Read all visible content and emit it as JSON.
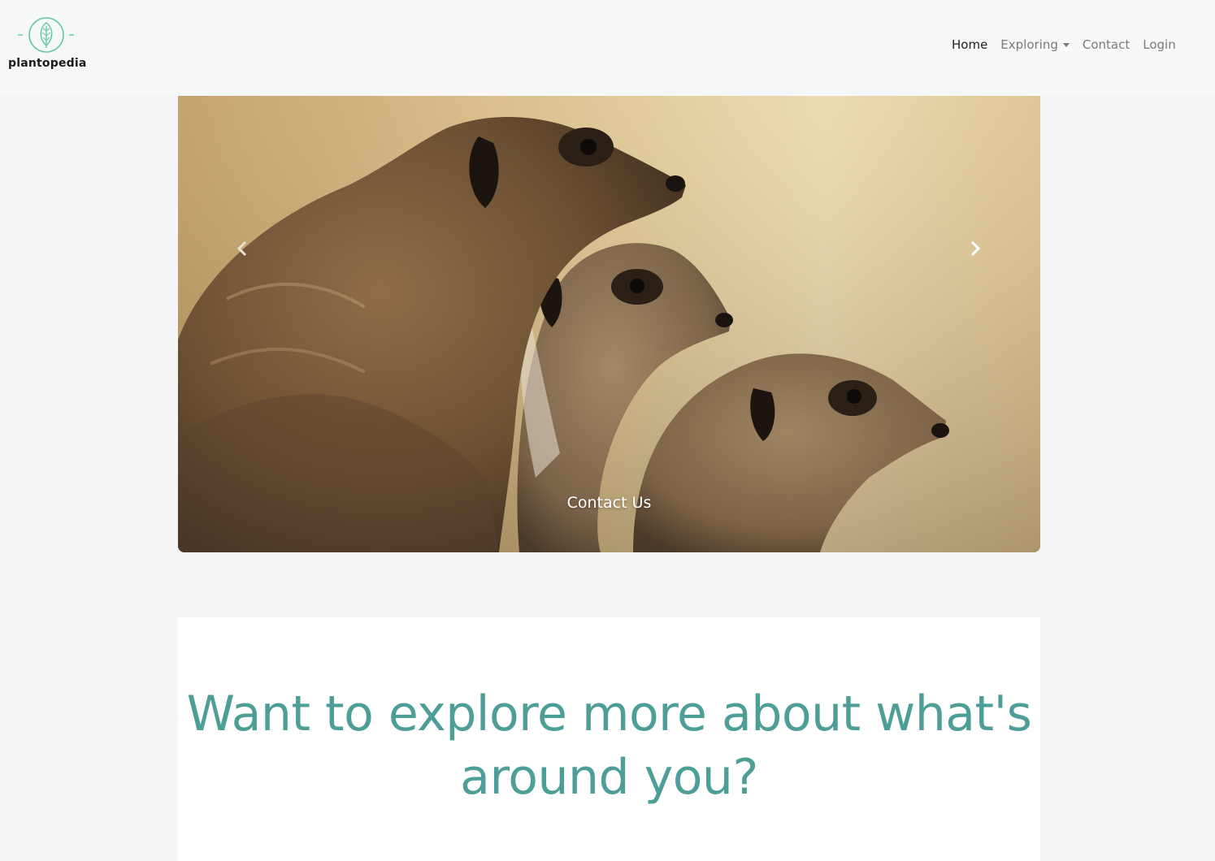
{
  "brand": {
    "name": "plantopedia",
    "logo_icon": "leaf-circle-icon",
    "accent_color": "#63c7a6"
  },
  "nav": {
    "home": "Home",
    "exploring": "Exploring",
    "contact": "Contact",
    "login": "Login"
  },
  "carousel": {
    "image": "meerkats-photo",
    "caption": "Contact Us",
    "prev_icon": "chevron-left-icon",
    "next_icon": "chevron-right-icon"
  },
  "intro": {
    "heading": "Want to explore more about what's around you?",
    "heading_color": "#4e9e98"
  }
}
